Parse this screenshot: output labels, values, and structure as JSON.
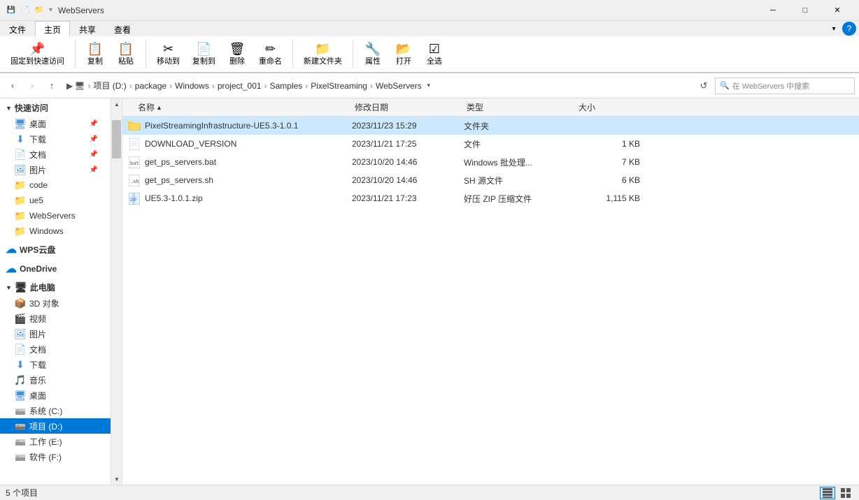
{
  "titlebar": {
    "title": "WebServers",
    "icons": [
      "💾",
      "📄",
      "📁"
    ],
    "min": "─",
    "max": "□",
    "close": "✕"
  },
  "ribbon": {
    "tabs": [
      "文件",
      "主页",
      "共享",
      "查看"
    ],
    "active_tab": "主页"
  },
  "toolbar": {
    "buttons": [
      {
        "label": "复制",
        "icon": "⎘"
      },
      {
        "label": "粘贴",
        "icon": "📋"
      },
      {
        "label": "移动到",
        "icon": "📤"
      },
      {
        "label": "复制到",
        "icon": "📥"
      },
      {
        "label": "删除",
        "icon": "🗑"
      },
      {
        "label": "重命名",
        "icon": "✏"
      }
    ]
  },
  "nav": {
    "back_disabled": false,
    "forward_disabled": true,
    "up": "↑",
    "breadcrumb": [
      {
        "label": "此电脑"
      },
      {
        "label": "项目 (D:)"
      },
      {
        "label": "package"
      },
      {
        "label": "Windows"
      },
      {
        "label": "project_001"
      },
      {
        "label": "Samples"
      },
      {
        "label": "PixelStreaming"
      },
      {
        "label": "WebServers"
      }
    ],
    "search_placeholder": "在 WebServers 中搜索"
  },
  "sidebar": {
    "sections": [
      {
        "id": "quick-access",
        "header": "快速访问",
        "items": [
          {
            "label": "桌面",
            "icon": "desktop",
            "pinned": true
          },
          {
            "label": "下载",
            "icon": "download",
            "pinned": true
          },
          {
            "label": "文档",
            "icon": "docs",
            "pinned": true
          },
          {
            "label": "图片",
            "icon": "images",
            "pinned": true
          },
          {
            "label": "code",
            "icon": "folder"
          },
          {
            "label": "ue5",
            "icon": "folder"
          },
          {
            "label": "WebServers",
            "icon": "folder"
          },
          {
            "label": "Windows",
            "icon": "folder"
          }
        ]
      },
      {
        "id": "wps",
        "header": "WPS云盘",
        "items": []
      },
      {
        "id": "onedrive",
        "header": "OneDrive",
        "items": []
      },
      {
        "id": "this-pc",
        "header": "此电脑",
        "items": [
          {
            "label": "3D 对象",
            "icon": "3d"
          },
          {
            "label": "视频",
            "icon": "video"
          },
          {
            "label": "图片",
            "icon": "images"
          },
          {
            "label": "文档",
            "icon": "docs"
          },
          {
            "label": "下载",
            "icon": "download"
          },
          {
            "label": "音乐",
            "icon": "music"
          },
          {
            "label": "桌面",
            "icon": "desktop"
          },
          {
            "label": "系统 (C:)",
            "icon": "drive"
          },
          {
            "label": "项目 (D:)",
            "icon": "drive",
            "active": true
          },
          {
            "label": "工作 (E:)",
            "icon": "drive"
          },
          {
            "label": "软件 (F:)",
            "icon": "drive"
          }
        ]
      }
    ]
  },
  "filelist": {
    "columns": [
      {
        "label": "名称",
        "key": "name",
        "sort": "asc"
      },
      {
        "label": "修改日期",
        "key": "date"
      },
      {
        "label": "类型",
        "key": "type"
      },
      {
        "label": "大小",
        "key": "size"
      }
    ],
    "files": [
      {
        "name": "PixelStreamingInfrastructure-UE5.3-1.0.1",
        "date": "2023/11/23 15:29",
        "type": "文件夹",
        "size": "",
        "icon": "folder-open"
      },
      {
        "name": "DOWNLOAD_VERSION",
        "date": "2023/11/21 17:25",
        "type": "文件",
        "size": "1 KB",
        "icon": "file"
      },
      {
        "name": "get_ps_servers.bat",
        "date": "2023/10/20 14:46",
        "type": "Windows 批处理...",
        "size": "7 KB",
        "icon": "bat"
      },
      {
        "name": "get_ps_servers.sh",
        "date": "2023/10/20 14:46",
        "type": "SH 源文件",
        "size": "6 KB",
        "icon": "sh"
      },
      {
        "name": "UE5.3-1.0.1.zip",
        "date": "2023/11/21 17:23",
        "type": "好压 ZIP 压缩文件",
        "size": "1,115 KB",
        "icon": "zip"
      }
    ]
  },
  "statusbar": {
    "count": "5 个项目",
    "view_detail": "detail",
    "view_large": "large"
  }
}
